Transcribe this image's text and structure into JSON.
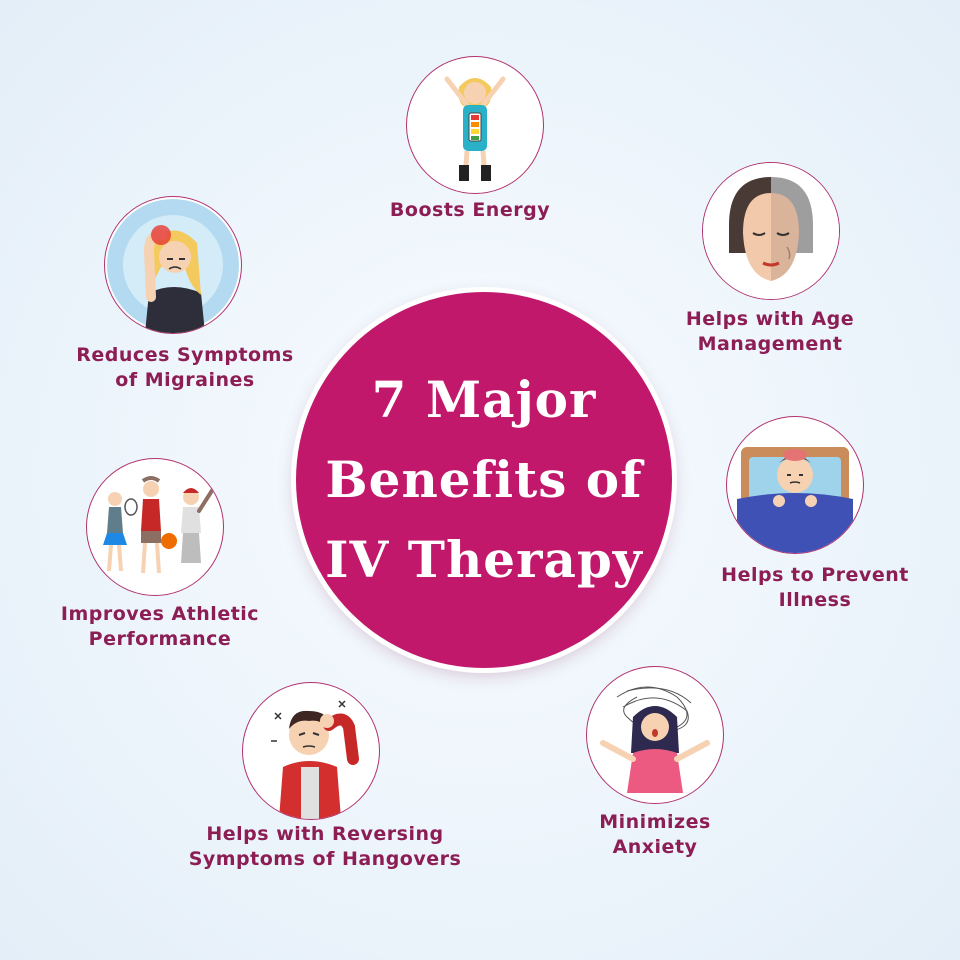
{
  "title": {
    "lines": [
      "7 Major",
      "Benefits of",
      "IV Therapy"
    ]
  },
  "colors": {
    "accent": "#c2186b",
    "label": "#8c1d55",
    "background": "#ecf4fb"
  },
  "benefits": [
    {
      "icon": "energized-woman-icon",
      "lines": [
        "Boosts Energy"
      ]
    },
    {
      "icon": "age-face-icon",
      "lines": [
        "Helps with Age",
        "Management"
      ]
    },
    {
      "icon": "sick-child-icon",
      "lines": [
        "Helps to Prevent",
        "Illness"
      ]
    },
    {
      "icon": "anxious-woman-icon",
      "lines": [
        "Minimizes",
        "Anxiety"
      ]
    },
    {
      "icon": "hungover-man-icon",
      "lines": [
        "Helps with Reversing",
        "Symptoms of Hangovers"
      ]
    },
    {
      "icon": "athletes-icon",
      "lines": [
        "Improves Athletic",
        "Performance"
      ]
    },
    {
      "icon": "migraine-woman-icon",
      "lines": [
        "Reduces Symptoms",
        "of Migraines"
      ]
    }
  ]
}
